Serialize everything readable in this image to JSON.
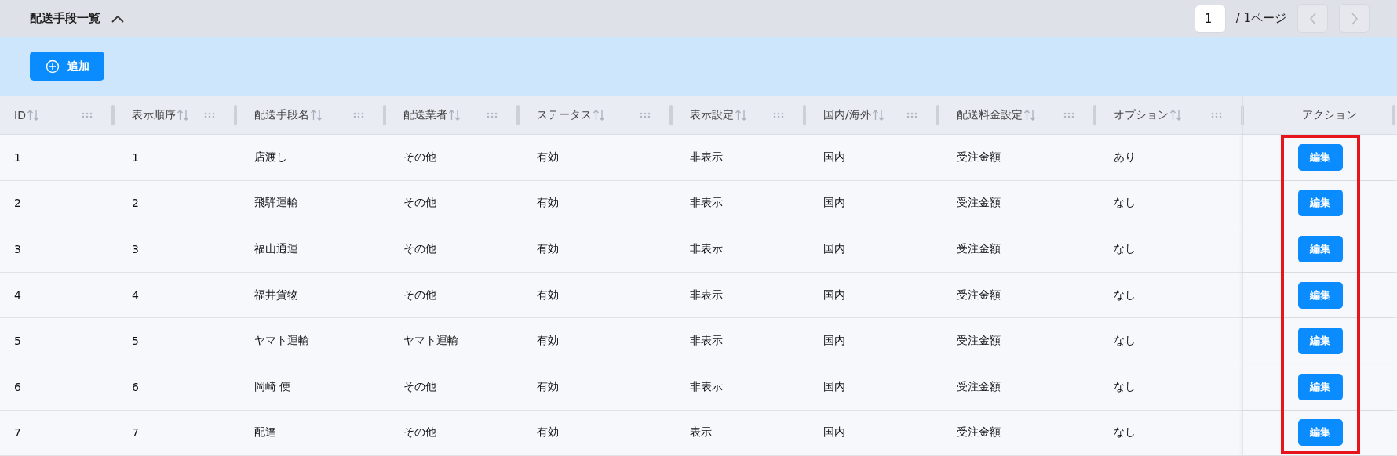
{
  "panel": {
    "title": "配送手段一覧",
    "expanded": true
  },
  "pagination": {
    "page": "1",
    "total": "/ 1ページ",
    "prev_disabled": true,
    "next_disabled": true
  },
  "toolbar": {
    "add_button": "追加"
  },
  "table": {
    "columns": [
      {
        "label": "ID",
        "kind": "data"
      },
      {
        "label": "表示順序",
        "kind": "data"
      },
      {
        "label": "配送手段名",
        "kind": "data"
      },
      {
        "label": "配送業者",
        "kind": "data"
      },
      {
        "label": "ステータス",
        "kind": "data"
      },
      {
        "label": "表示設定",
        "kind": "data"
      },
      {
        "label": "国内/海外",
        "kind": "data"
      },
      {
        "label": "配送料金設定",
        "kind": "data"
      },
      {
        "label": "オプション",
        "kind": "data"
      },
      {
        "label": "アクション",
        "kind": "action"
      }
    ],
    "rows": [
      {
        "cells": [
          "1",
          "1",
          "店渡し",
          "その他",
          "有効",
          "非表示",
          "国内",
          "受注金額",
          "あり"
        ],
        "action": "編集"
      },
      {
        "cells": [
          "2",
          "2",
          "飛騨運輸",
          "その他",
          "有効",
          "非表示",
          "国内",
          "受注金額",
          "なし"
        ],
        "action": "編集"
      },
      {
        "cells": [
          "3",
          "3",
          "福山通運",
          "その他",
          "有効",
          "非表示",
          "国内",
          "受注金額",
          "なし"
        ],
        "action": "編集"
      },
      {
        "cells": [
          "4",
          "4",
          "福井貨物",
          "その他",
          "有効",
          "非表示",
          "国内",
          "受注金額",
          "なし"
        ],
        "action": "編集"
      },
      {
        "cells": [
          "5",
          "5",
          "ヤマト運輸",
          "ヤマト運輸",
          "有効",
          "非表示",
          "国内",
          "受注金額",
          "なし"
        ],
        "action": "編集"
      },
      {
        "cells": [
          "6",
          "6",
          "岡崎 便",
          "その他",
          "有効",
          "非表示",
          "国内",
          "受注金額",
          "なし"
        ],
        "action": "編集"
      },
      {
        "cells": [
          "7",
          "7",
          "配達",
          "その他",
          "有効",
          "表示",
          "国内",
          "受注金額",
          "なし"
        ],
        "action": "編集"
      }
    ],
    "action_highlight": true
  }
}
